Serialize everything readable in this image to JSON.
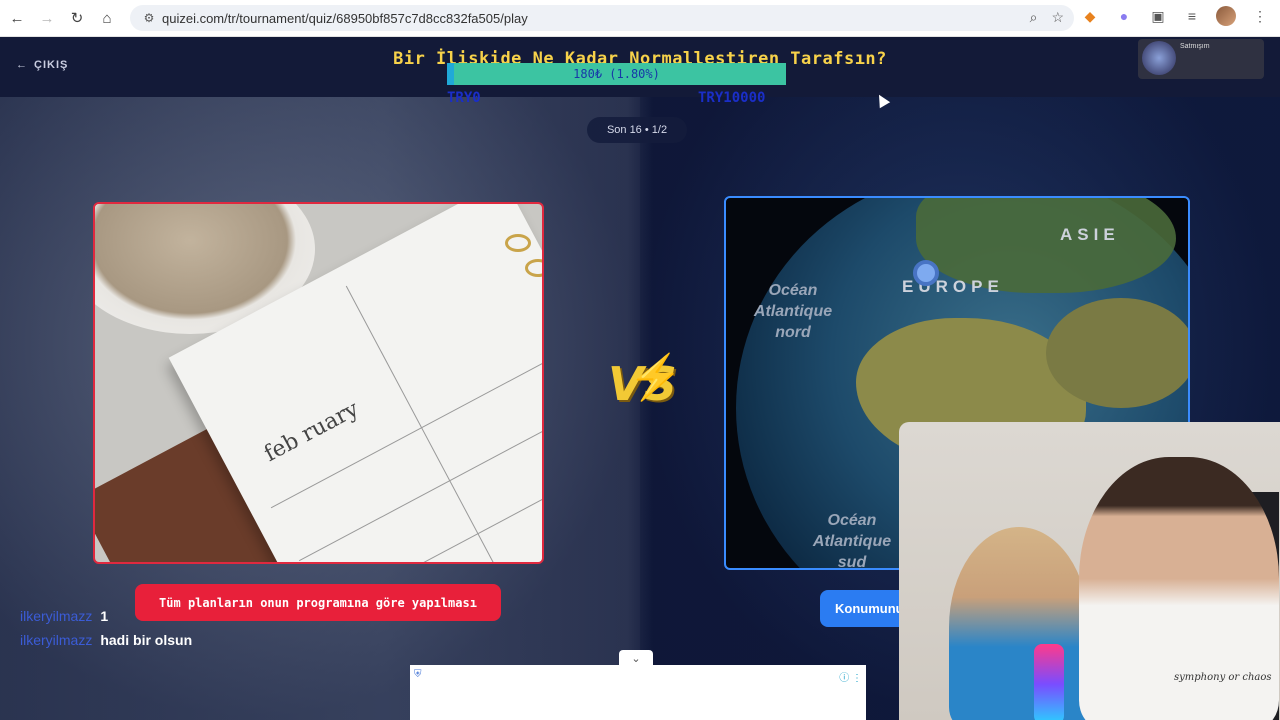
{
  "browser": {
    "url": "quizei.com/tr/tournament/quiz/68950bf857c7d8cc832fa505/play"
  },
  "topbar": {
    "exit_label": "ÇIKIŞ",
    "title": "Bir İlişkide Ne Kadar Normalleştiren Tarafsın?",
    "progress": {
      "text": "180₺ (1.80%)",
      "fraction": 0.018,
      "goal_start": "TRY0",
      "goal_end": "TRY10000"
    },
    "mini_player_name": "Satmışım"
  },
  "round": {
    "label": "Son 16 • 1/2"
  },
  "left_card": {
    "planner_title": "feb ruary",
    "answer": "Tüm planların onun programına göre yapılması"
  },
  "right_card": {
    "labels": {
      "asia": "ASIE",
      "europe": "EUROPE",
      "atlantic_north": "Océan Atlantique nord",
      "atlantic_south": "Océan Atlantique sud"
    },
    "answer": "Konumunu"
  },
  "vs_label": "VS",
  "chat": [
    {
      "user": "ilkeryilmazz",
      "message": "1"
    },
    {
      "user": "ilkeryilmazz",
      "message": "hadi bir olsun"
    }
  ],
  "webcam": {
    "shirt_text": "symphony or chaos"
  },
  "colors": {
    "title": "#f7d24a",
    "left_accent": "#e0293f",
    "right_accent": "#3a8cff",
    "progress": "#3cc4a2"
  }
}
